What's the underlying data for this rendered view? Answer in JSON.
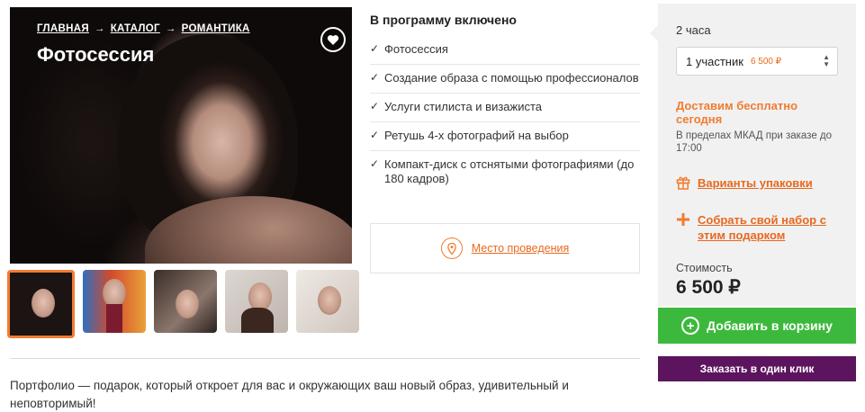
{
  "breadcrumb": {
    "items": [
      "ГЛАВНАЯ",
      "КАТАЛОГ",
      "РОМАНТИКА"
    ],
    "separator": "→"
  },
  "product": {
    "title": "Фотосессия",
    "description": "Портфолио — подарок, который откроет для вас и окружающих ваш новый образ, удивительный и неповторимый!"
  },
  "included": {
    "title": "В программу включено",
    "check_icon": "✓",
    "items": [
      "Фотосессия",
      "Создание образа с помощью профессионалов",
      "Услуги стилиста и визажиста",
      "Ретушь 4-х фотографий на выбор",
      "Компакт-диск с отснятыми фотографиями (до 180 кадров)"
    ]
  },
  "venue": {
    "label": "Место проведения",
    "icon": "location-pin-icon"
  },
  "order": {
    "duration": "2 часа",
    "participants": {
      "selected": "1 участник",
      "price": "6 500 ₽"
    },
    "delivery_title": "Доставим бесплатно сегодня",
    "delivery_note": "В пределах МКАД при заказе до 17:00",
    "packaging_link": "Варианты упаковки",
    "build_set_link": "Собрать свой набор с этим подарком",
    "price_label": "Стоимость",
    "price_value": "6 500 ₽",
    "add_to_cart": "Добавить в корзину",
    "one_click": "Заказать в один клик"
  },
  "colors": {
    "accent": "#f07c32",
    "link": "#e8691f",
    "cart_button": "#3cb93c",
    "one_click_button": "#5d145f",
    "panel_bg": "#f1f1f1"
  },
  "thumbnails": {
    "count": 5,
    "active_index": 0,
    "backgrounds": [
      "#1b1412",
      "#d44a2a",
      "#2a201d",
      "#ddd6d2",
      "#e9e3de"
    ]
  }
}
